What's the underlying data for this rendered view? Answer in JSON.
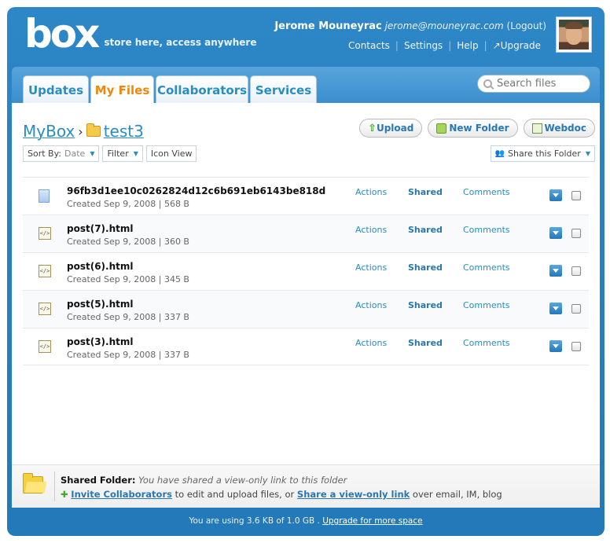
{
  "header": {
    "logo": "box",
    "tagline": "store here, access anywhere",
    "user_name": "Jerome Mouneyrac",
    "user_email": "jerome@mouneyrac.com",
    "logout": "(Logout)",
    "links": [
      "Contacts",
      "Settings",
      "Help",
      "↗Upgrade"
    ]
  },
  "tabs": [
    "Updates",
    "My Files",
    "Collaborators",
    "Services"
  ],
  "active_tab": "My Files",
  "search": {
    "placeholder": "Search files"
  },
  "breadcrumb": {
    "root": "MyBox",
    "separator": "›",
    "folder": "test3"
  },
  "buttons": {
    "upload": "Upload",
    "new_folder": "New Folder",
    "webdoc": "Webdoc"
  },
  "toolbar": {
    "sort_by": "Sort By:",
    "sort_value": "Date",
    "filter": "Filter",
    "icon_view": "Icon View",
    "share_folder": "Share this Folder"
  },
  "files": [
    {
      "name": "96fb3d1ee10c0262824d12c6b691eb6143be818d",
      "meta": "Created Sep 9, 2008   |   568 B",
      "type": "doc",
      "actions": "Actions",
      "shared": "Shared",
      "comments": "Comments"
    },
    {
      "name": "post(7).html",
      "meta": "Created Sep 9, 2008   |   360 B",
      "type": "html",
      "actions": "Actions",
      "shared": "Shared",
      "comments": "Comments"
    },
    {
      "name": "post(6).html",
      "meta": "Created Sep 9, 2008   |   345 B",
      "type": "html",
      "actions": "Actions",
      "shared": "Shared",
      "comments": "Comments"
    },
    {
      "name": "post(5).html",
      "meta": "Created Sep 9, 2008   |   337 B",
      "type": "html",
      "actions": "Actions",
      "shared": "Shared",
      "comments": "Comments"
    },
    {
      "name": "post(3).html",
      "meta": "Created Sep 9, 2008   |   337 B",
      "type": "html",
      "actions": "Actions",
      "shared": "Shared",
      "comments": "Comments"
    }
  ],
  "shared_info": {
    "title": "Shared Folder:",
    "desc": "You have shared a view-only link to this folder",
    "invite": "Invite Collaborators",
    "mid": " to edit and upload files, or ",
    "share_link": "Share a view-only link",
    "tail": " over email, IM, blog"
  },
  "usage": {
    "text": "You are using 3.6 KB of 1.0 GB . ",
    "link": "Upgrade for more space"
  },
  "colors": {
    "frame": "#2b7fbd",
    "active_tab": "#f0870d",
    "link": "#2a8dc0"
  }
}
